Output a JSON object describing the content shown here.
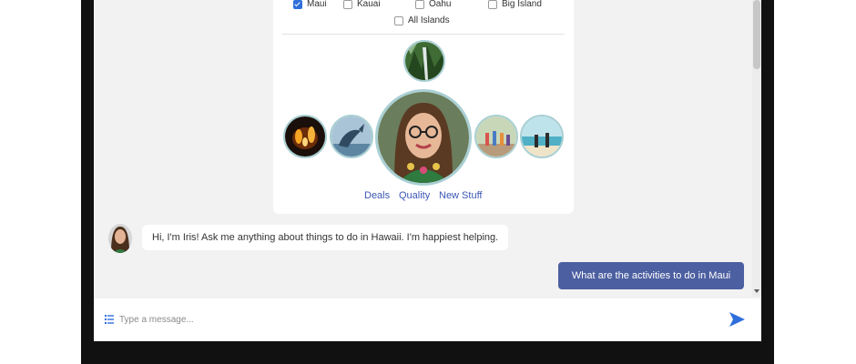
{
  "island_filter": {
    "options": [
      {
        "label": "Maui",
        "checked": true
      },
      {
        "label": "Kauai",
        "checked": false
      },
      {
        "label": "Oahu",
        "checked": false
      },
      {
        "label": "Big Island",
        "checked": false
      },
      {
        "label": "All Islands",
        "checked": false
      }
    ]
  },
  "topic_links": [
    "Deals",
    "Quality",
    "New Stuff"
  ],
  "chat": {
    "bot_message": "Hi, I'm Iris! Ask me anything about things to do in Hawaii. I'm happiest helping.",
    "user_message": "What are the activities to do in Maui"
  },
  "composer": {
    "placeholder": "Type a message..."
  },
  "icons": {
    "menu": "list-icon",
    "send": "send-arrow-icon"
  },
  "colors": {
    "accent": "#2f6fdb",
    "user_bubble": "#4c5fa0",
    "link": "#3b55b5"
  }
}
